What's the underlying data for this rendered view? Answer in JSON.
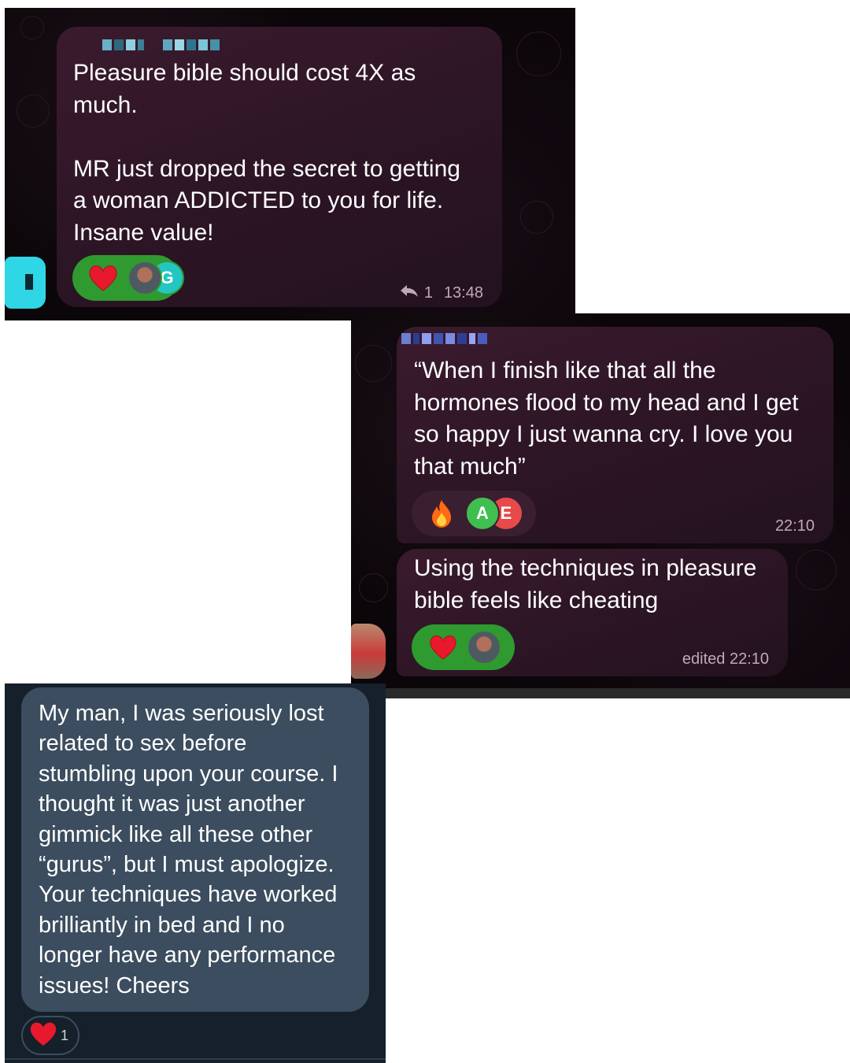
{
  "shot1": {
    "message": "Pleasure bible should cost 4X as\nmuch.\n\nMR just dropped the secret to getting\na woman ADDICTED to you for life.\nInsane value!",
    "reaction_emoji": "heart",
    "reactor_initial": "G",
    "reply_count": "1",
    "time": "13:48"
  },
  "shot2": {
    "message1": "“When I finish like that all the\nhormones flood to my head and I get\nso happy I just wanna cry. I love you\nthat much”",
    "reaction1_emoji": "fire",
    "reactor1_initial": "A",
    "reactor2_initial": "E",
    "time1": "22:10",
    "message2": "Using the techniques in pleasure\nbible feels like cheating",
    "reaction2_emoji": "heart",
    "time2": "edited 22:10"
  },
  "shot3": {
    "message": "My man, I was seriously lost\nrelated to sex before\nstumbling upon your course. I\nthought it was just another\ngimmick like all these other\n“gurus”, but I must apologize.\nYour techniques have worked\nbrilliantly in bed and I no\nlonger have any performance\nissues! Cheers",
    "reaction_emoji": "heart",
    "reaction_count": "1"
  },
  "colors": {
    "telegram_bg": "#0b0609",
    "bubble": "#2c1525",
    "reaction_green": "#2f9a2f",
    "twitter_bg": "#15202b",
    "twitter_bubble": "#3b4d5e",
    "heart_red": "#e8192c"
  }
}
